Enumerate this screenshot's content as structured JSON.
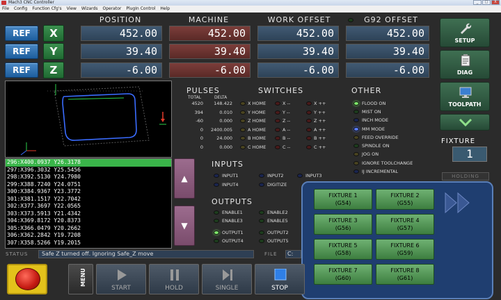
{
  "window": {
    "title": "Mach3 CNC Controller",
    "controls": [
      "_",
      "□",
      "X"
    ]
  },
  "menu": [
    "File",
    "Config",
    "Function Cfg's",
    "View",
    "Wizards",
    "Operator",
    "PlugIn Control",
    "Help"
  ],
  "dro": {
    "headers": {
      "position": "POSITION",
      "machine": "MACHINE",
      "work_offset": "WORK OFFSET",
      "g92_offset": "G92 OFFSET"
    },
    "ref_label": "REF",
    "axes": [
      {
        "name": "X",
        "position": "452.00",
        "machine": "452.00",
        "work": "452.00",
        "g92": "452.00"
      },
      {
        "name": "Y",
        "position": "39.40",
        "machine": "39.40",
        "work": "39.40",
        "g92": "39.40"
      },
      {
        "name": "Z",
        "position": "-6.00",
        "machine": "-6.00",
        "work": "-6.00",
        "g92": "-6.00"
      }
    ]
  },
  "tools": {
    "setup": "SETUP",
    "diag": "DIAG",
    "toolpath": "TOOLPATH"
  },
  "gcode": {
    "lines": [
      "296:X400.0937 Y26.3178",
      "297:X396.3032 Y25.5456",
      "298:X392.5130 Y24.7980",
      "299:X388.7240 Y24.0751",
      "300:X384.9367 Y23.3772",
      "301:X381.1517 Y22.7042",
      "302:X377.3697 Y22.0565",
      "303:X373.5913 Y21.4342",
      "304:X369.8172 Y20.8373",
      "305:X366.0479 Y20.2662",
      "306:X362.2842 Y19.7208",
      "307:X358.5266 Y19.2015"
    ]
  },
  "pulses": {
    "title": "PULSES",
    "col_total": "TOTAL",
    "col_delta": "DELTA",
    "rows": [
      {
        "total": "4520",
        "delta": "148.422"
      },
      {
        "total": "394",
        "delta": "0.010"
      },
      {
        "total": "-60",
        "delta": "0.000"
      },
      {
        "total": "0",
        "delta": "2400.005"
      },
      {
        "total": "0",
        "delta": "24.000"
      },
      {
        "total": "0",
        "delta": "0.000"
      }
    ]
  },
  "switches": {
    "title": "SWITCHES",
    "rows": [
      {
        "home": "X HOME",
        "minus": "X --",
        "plus": "X ++"
      },
      {
        "home": "Y HOME",
        "minus": "Y --",
        "plus": "Y ++"
      },
      {
        "home": "Z HOME",
        "minus": "Z --",
        "plus": "Z ++"
      },
      {
        "home": "A HOME",
        "minus": "A --",
        "plus": "A ++"
      },
      {
        "home": "B HOME",
        "minus": "B --",
        "plus": "B ++"
      },
      {
        "home": "C HOME",
        "minus": "C --",
        "plus": "C ++"
      }
    ]
  },
  "other": {
    "title": "OTHER",
    "items": [
      {
        "label": "FLOOD ON",
        "state": "on-grn"
      },
      {
        "label": "MIST ON",
        "state": "off-grn"
      },
      {
        "label": "INCH MODE",
        "state": "off-blu"
      },
      {
        "label": "MM MODE",
        "state": "on-blu"
      },
      {
        "label": "FEED OVERRIDE",
        "state": "off-yel"
      },
      {
        "label": "SPINDLE ON",
        "state": "off-grn"
      },
      {
        "label": "JOG ON",
        "state": "off-yel"
      },
      {
        "label": "IGNORE TOOLCHANGE",
        "state": "off-yel"
      },
      {
        "label": "IJ INCREMENTAL",
        "state": "off-blu"
      }
    ]
  },
  "inputs": {
    "title": "INPUTS",
    "items": [
      "INPUT1",
      "INPUT2",
      "INPUT3",
      "INPUT4",
      "DIGITIZE"
    ]
  },
  "outputs": {
    "title": "OUTPUTS",
    "items": [
      "ENABLE1",
      "ENABLE2",
      "ENABLE3",
      "ENABLE5",
      "OUTPUT1",
      "OUTPUT2",
      "OUTPUT4",
      "OUTPUT5"
    ]
  },
  "fixture": {
    "label": "FIXTURE",
    "value": "1",
    "holding": "HOLDING",
    "buttons": [
      {
        "name": "FIXTURE 1",
        "code": "(G54)"
      },
      {
        "name": "FIXTURE 2",
        "code": "(G55)"
      },
      {
        "name": "FIXTURE 3",
        "code": "(G56)"
      },
      {
        "name": "FIXTURE 4",
        "code": "(G57)"
      },
      {
        "name": "FIXTURE 5",
        "code": "(G58)"
      },
      {
        "name": "FIXTURE 6",
        "code": "(G59)"
      },
      {
        "name": "FIXTURE 7",
        "code": "(G60)"
      },
      {
        "name": "FIXTURE 8",
        "code": "(G61)"
      }
    ]
  },
  "status": {
    "label": "STATUS",
    "message": "Safe Z turned off. Ignoring Safe_Z move",
    "file_label": "FILE",
    "file_value": "C:"
  },
  "controls": {
    "menu": "MENU",
    "start": "START",
    "hold": "HOLD",
    "single": "SINGLE",
    "stop": "STOP"
  }
}
